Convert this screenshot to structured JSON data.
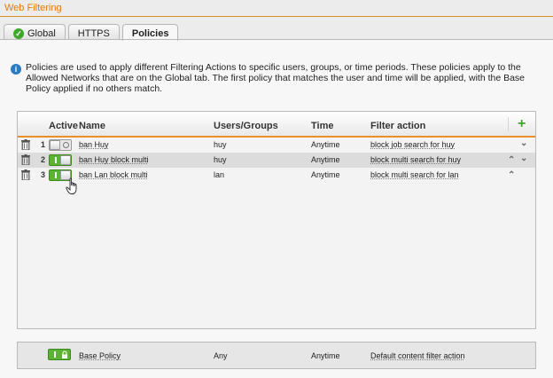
{
  "app": {
    "title": "Web Filtering"
  },
  "tabs": [
    {
      "label": "Global",
      "icon": "check-circle-icon",
      "status_color": "#3fa72c"
    },
    {
      "label": "HTTPS"
    },
    {
      "label": "Policies",
      "active": true
    }
  ],
  "info": {
    "icon": "info-icon",
    "text": "Policies are used to apply different Filtering Actions to specific users, groups, or time periods. These policies apply to the Allowed Networks that are on the Global tab. The first policy that matches the user and time will be applied, with the Base Policy applied if no others match."
  },
  "table": {
    "headers": {
      "active": "Active",
      "name": "Name",
      "users": "Users/Groups",
      "time": "Time",
      "filter": "Filter action",
      "add_icon": "plus-icon"
    },
    "rows": [
      {
        "num": "1",
        "active": false,
        "name": "ban Huy",
        "users": "huy",
        "time": "Anytime",
        "filter": "block job search for huy",
        "arrows": [
          "down"
        ]
      },
      {
        "num": "2",
        "active": true,
        "name": "ban Huy block multi",
        "users": "huy",
        "time": "Anytime",
        "filter": "block multi search for huy",
        "arrows": [
          "up",
          "down"
        ]
      },
      {
        "num": "3",
        "active": true,
        "name": "ban Lan block multi",
        "users": "lan",
        "time": "Anytime",
        "filter": "block multi search for lan",
        "arrows": [
          "up"
        ]
      }
    ]
  },
  "base_policy": {
    "active": true,
    "locked": true,
    "name": "Base Policy",
    "users": "Any",
    "time": "Anytime",
    "filter": "Default content filter action"
  },
  "colors": {
    "accent": "#e8912a",
    "toggle_on": "#5cb233",
    "info_blue": "#2b7bc0"
  }
}
